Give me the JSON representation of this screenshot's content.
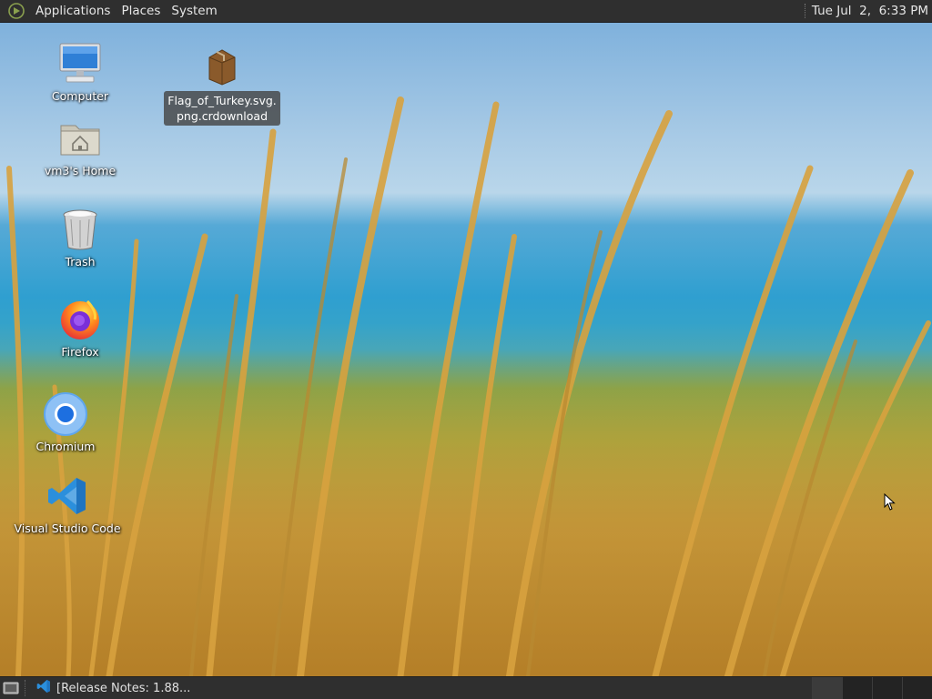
{
  "top_panel": {
    "menus": [
      "Applications",
      "Places",
      "System"
    ],
    "clock": "Tue Jul  2,  6:33 PM"
  },
  "desktop_icons": {
    "computer": "Computer",
    "home": "vm3's Home",
    "trash": "Trash",
    "firefox": "Firefox",
    "chromium": "Chromium",
    "vscode": "Visual Studio Code",
    "download_line1": "Flag_of_Turkey.svg.",
    "download_line2": "png.crdownload"
  },
  "bottom_panel": {
    "task_label": "[Release Notes: 1.88..."
  },
  "colors": {
    "panel_bg": "#2f2f2f",
    "panel_text": "#e6e6e6",
    "vscode_blue": "#2b8fdc"
  }
}
